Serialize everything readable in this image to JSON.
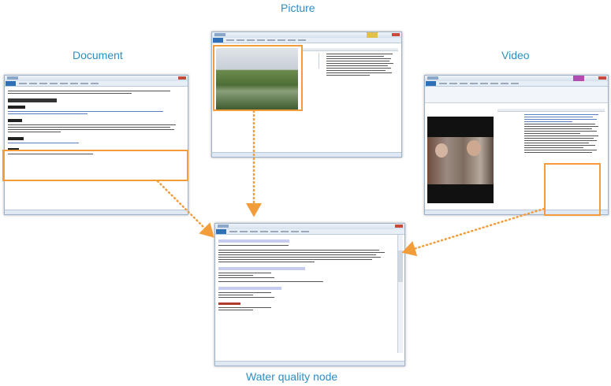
{
  "labels": {
    "document": "Document",
    "picture": "Picture",
    "video": "Video",
    "node": "Water quality node"
  },
  "colors": {
    "caption": "#2b8fc6",
    "highlight": "#f39c3a",
    "title_bar": "#d5e1ee",
    "file_button": "#2e6fb6",
    "coding_highlight": "#c6cbf0",
    "node_heading": "#b03a2e"
  },
  "icons": {
    "quick_access": "quick-access-toolbar-icon",
    "close": "close-icon",
    "arrow": "dotted-arrow-icon"
  }
}
